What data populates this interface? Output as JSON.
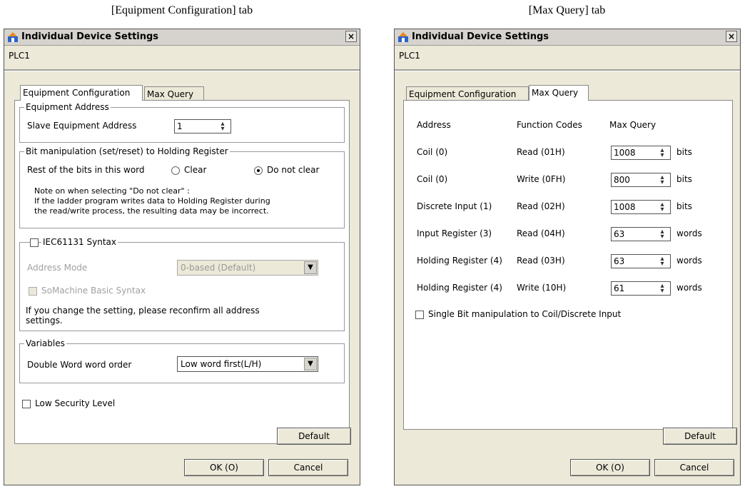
{
  "captions": {
    "left": "[Equipment Configuration] tab",
    "right": "[Max Query] tab"
  },
  "dialog": {
    "title": "Individual Device Settings",
    "close_glyph": "×",
    "device": "PLC1",
    "tabs": [
      "Equipment Configuration",
      "Max Query"
    ],
    "default_button": "Default",
    "ok_button": "OK (O)",
    "cancel_button": "Cancel"
  },
  "equipment": {
    "address_group": "Equipment Address",
    "slave_label": "Slave Equipment Address",
    "slave_value": "1",
    "bit_group": "Bit manipulation (set/reset) to Holding Register",
    "rest_label": "Rest of the bits in this word",
    "clear_label": "Clear",
    "not_clear_label": "Do not clear",
    "selected_option": "Do not clear",
    "note_line1": "Note on when selecting \"Do not clear\" :",
    "note_line2": "If the ladder program writes data to Holding Register during",
    "note_line3": "the read/write process, the resulting data may be incorrect.",
    "iec_label": "IEC61131 Syntax",
    "address_mode_label": "Address Mode",
    "address_mode_value": "0-based (Default)",
    "somachine_label": "SoMachine Basic Syntax",
    "reconfirm_line1": "If you change the setting, please reconfirm all address",
    "reconfirm_line2": "settings.",
    "variables_group": "Variables",
    "dword_label": "Double Word word order",
    "dword_value": "Low word first(L/H)",
    "low_security_label": "Low Security Level"
  },
  "maxquery": {
    "headers": [
      "Address",
      "Function Codes",
      "Max Query"
    ],
    "rows": [
      {
        "address": "Coil (0)",
        "function": "Read (01H)",
        "value": "1008",
        "unit": "bits"
      },
      {
        "address": "Coil (0)",
        "function": "Write (0FH)",
        "value": "800",
        "unit": "bits"
      },
      {
        "address": "Discrete Input (1)",
        "function": "Read (02H)",
        "value": "1008",
        "unit": "bits"
      },
      {
        "address": "Input Register (3)",
        "function": "Read (04H)",
        "value": "63",
        "unit": "words"
      },
      {
        "address": "Holding Register (4)",
        "function": "Read (03H)",
        "value": "63",
        "unit": "words"
      },
      {
        "address": "Holding Register (4)",
        "function": "Write (10H)",
        "value": "61",
        "unit": "words"
      }
    ],
    "single_bit_label": "Single Bit manipulation to Coil/Discrete Input"
  }
}
